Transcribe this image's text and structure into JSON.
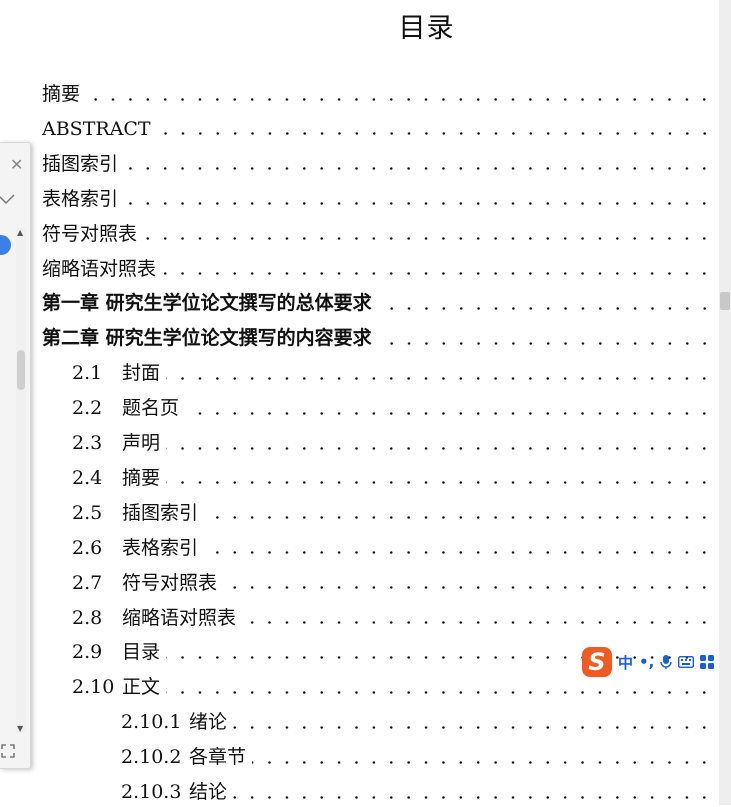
{
  "document": {
    "title": "目录",
    "entries": [
      {
        "number": "",
        "label": "摘要",
        "level": 0,
        "bold": false
      },
      {
        "number": "",
        "label": "ABSTRACT",
        "level": 0,
        "bold": false
      },
      {
        "number": "",
        "label": "插图索引",
        "level": 0,
        "bold": false
      },
      {
        "number": "",
        "label": "表格索引",
        "level": 0,
        "bold": false
      },
      {
        "number": "",
        "label": "符号对照表",
        "level": 0,
        "bold": false
      },
      {
        "number": "",
        "label": "缩略语对照表",
        "level": 0,
        "bold": false
      },
      {
        "number": "",
        "label": "第一章  研究生学位论文撰写的总体要求",
        "level": 0,
        "bold": true
      },
      {
        "number": "",
        "label": "第二章  研究生学位论文撰写的内容要求",
        "level": 0,
        "bold": true
      },
      {
        "number": "2.1",
        "label": "封面",
        "level": 1,
        "bold": false
      },
      {
        "number": "2.2",
        "label": "题名页",
        "level": 1,
        "bold": false
      },
      {
        "number": "2.3",
        "label": "声明",
        "level": 1,
        "bold": false
      },
      {
        "number": "2.4",
        "label": "摘要",
        "level": 1,
        "bold": false
      },
      {
        "number": "2.5",
        "label": "插图索引",
        "level": 1,
        "bold": false
      },
      {
        "number": "2.6",
        "label": "表格索引",
        "level": 1,
        "bold": false
      },
      {
        "number": "2.7",
        "label": "符号对照表",
        "level": 1,
        "bold": false
      },
      {
        "number": "2.8",
        "label": "缩略语对照表",
        "level": 1,
        "bold": false
      },
      {
        "number": "2.9",
        "label": "目录",
        "level": 1,
        "bold": false
      },
      {
        "number": "2.10",
        "label": "正文",
        "level": 1,
        "bold": false
      },
      {
        "number": "2.10.1",
        "label": "绪论",
        "level": 2,
        "bold": false
      },
      {
        "number": "2.10.2",
        "label": "各章节",
        "level": 2,
        "bold": false
      },
      {
        "number": "2.10.3",
        "label": "结论",
        "level": 2,
        "bold": false
      }
    ]
  },
  "side_panel": {
    "close_icon": "close-icon",
    "chevron_icon": "chevron-down-icon",
    "expand_icon": "expand-icon"
  },
  "ime_toolbar": {
    "logo": "S",
    "mode": "中",
    "punct": "•,",
    "icons": [
      "microphone-icon",
      "keyboard-icon",
      "apps-grid-icon"
    ],
    "accent_color": "#f05b22",
    "text_color": "#1b5fd8"
  }
}
